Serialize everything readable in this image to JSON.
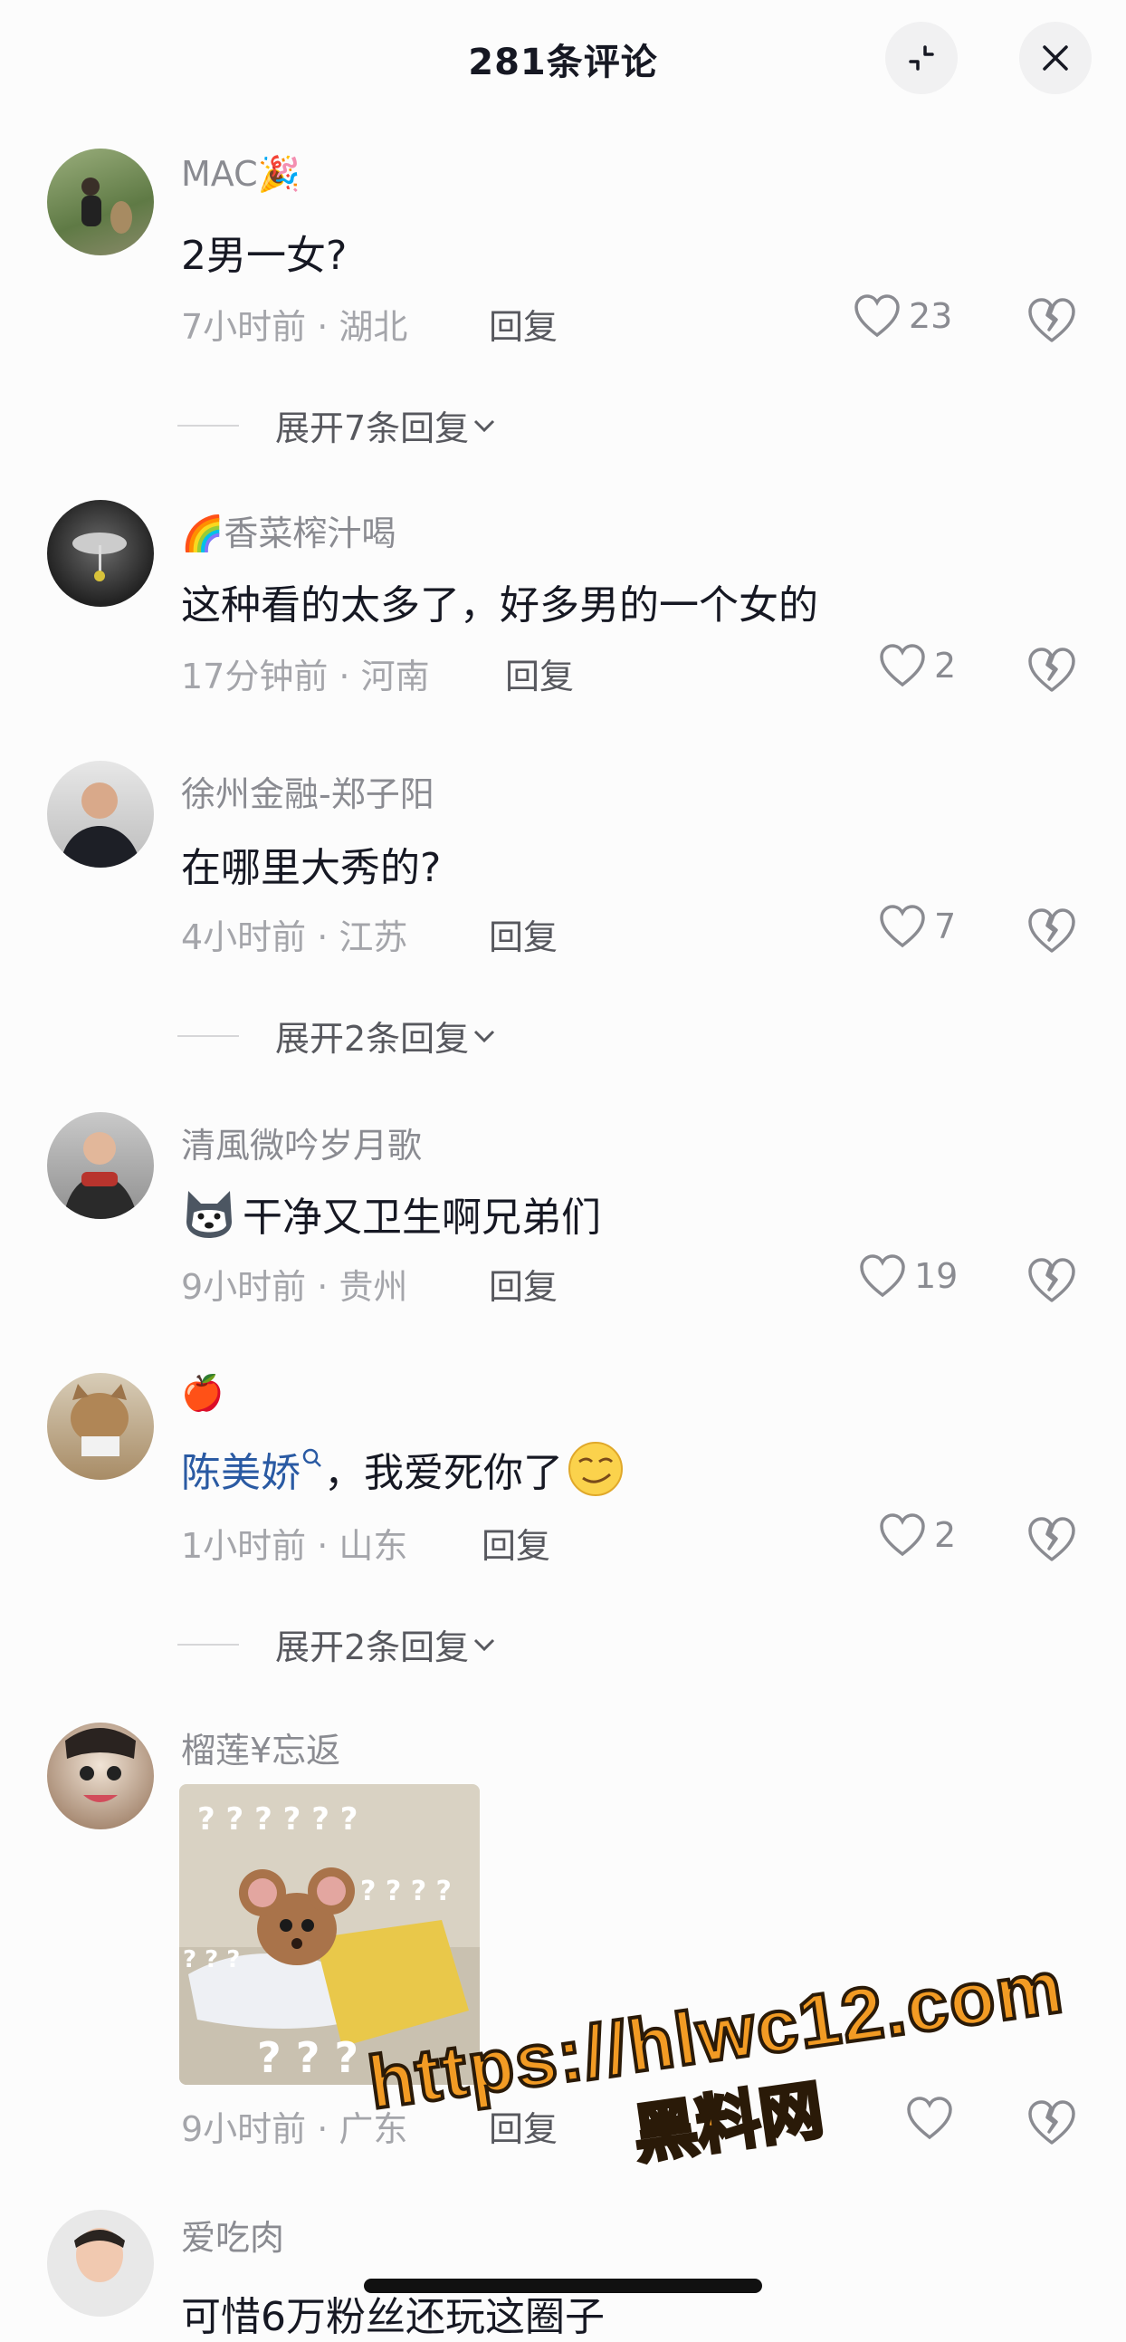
{
  "header": {
    "title": "281条评论"
  },
  "comments": [
    {
      "username": "MAC🎉",
      "text": "2男一女?",
      "time": "7小时前 · 湖北",
      "reply": "回复",
      "likes": "23",
      "expand": "展开7条回复"
    },
    {
      "username": "🌈香菜榨汁喝",
      "text": "这种看的太多了，好多男的一个女的",
      "time": "17分钟前 · 河南",
      "reply": "回复",
      "likes": "2"
    },
    {
      "username": "徐州金融-郑子阳",
      "text": "在哪里大秀的?",
      "time": "4小时前 · 江苏",
      "reply": "回复",
      "likes": "7",
      "expand": "展开2条回复"
    },
    {
      "username": "清風微吟岁月歌",
      "text": "干净又卫生啊兄弟们",
      "time": "9小时前 · 贵州",
      "reply": "回复",
      "likes": "19"
    },
    {
      "username": "🍎",
      "mention": "陈美娇",
      "text": "，我爱死你了",
      "time": "1小时前 · 山东",
      "reply": "回复",
      "likes": "2",
      "expand": "展开2条回复"
    },
    {
      "username": "榴莲¥忘返",
      "time": "9小时前 · 广东",
      "reply": "回复",
      "likes": ""
    },
    {
      "username": "爱吃肉",
      "text": "可惜6万粉丝还玩这圈子"
    }
  ],
  "sticker": {
    "marks_top": "? ? ? ? ? ?",
    "marks_mid": "? ? ? ?",
    "marks_left": "? ? ?",
    "marks_bottom": "? ? ?"
  },
  "watermark": {
    "url": "https://hlwc12.com",
    "name": "黑料网"
  }
}
